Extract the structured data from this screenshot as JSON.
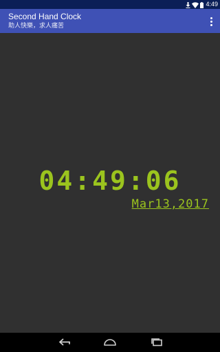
{
  "status_bar": {
    "time": "4:49"
  },
  "app_bar": {
    "title": "Second Hand Clock",
    "subtitle": "助人快樂，求人痛苦"
  },
  "clock": {
    "time": "04:49:06",
    "date": "Mar13,2017",
    "color": "#9bc41e"
  },
  "colors": {
    "app_bar": "#3f51b5",
    "status_bar": "#0b1f57",
    "background": "#303030"
  },
  "icons": {
    "overflow": "more-vert-icon",
    "back": "back-icon",
    "home": "home-icon",
    "recents": "recents-icon",
    "wifi": "wifi-icon",
    "battery": "battery-icon",
    "download": "download-icon"
  }
}
